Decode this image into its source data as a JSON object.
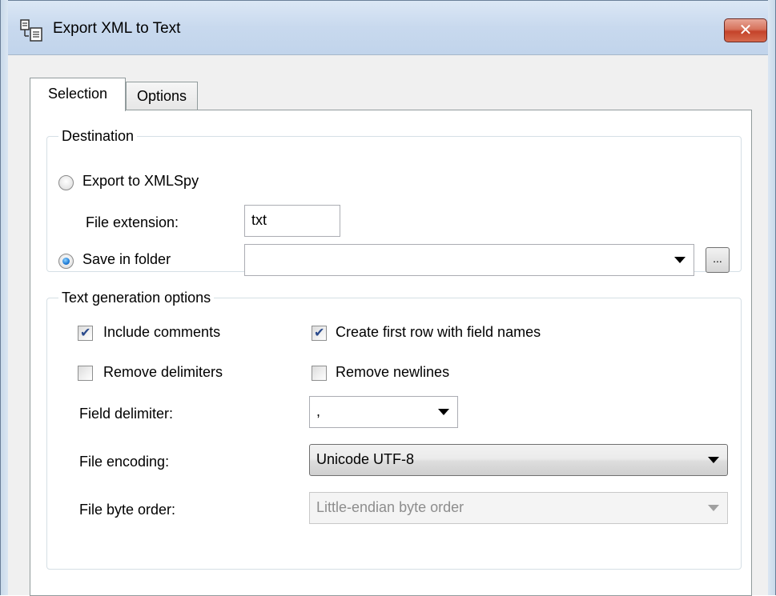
{
  "window": {
    "title": "Export XML to Text",
    "close_glyph": "✕",
    "icon": "export-text-icon"
  },
  "tabs": [
    {
      "label": "Selection",
      "active": true
    },
    {
      "label": "Options",
      "active": false
    }
  ],
  "destination": {
    "legend": "Destination",
    "export_radio_label": "Export to XMLSpy",
    "export_radio_checked": false,
    "file_extension_label": "File extension:",
    "file_extension_value": "txt",
    "save_radio_label": "Save in folder",
    "save_radio_checked": true,
    "folder_value": "",
    "browse_label": "..."
  },
  "text_options": {
    "legend": "Text generation options",
    "include_comments_label": "Include comments",
    "include_comments_checked": true,
    "create_first_row_label": "Create first row with field names",
    "create_first_row_checked": true,
    "remove_delimiters_label": "Remove delimiters",
    "remove_delimiters_checked": false,
    "remove_newlines_label": "Remove newlines",
    "remove_newlines_checked": false,
    "field_delimiter_label": "Field delimiter:",
    "field_delimiter_value": ",",
    "file_encoding_label": "File encoding:",
    "file_encoding_value": "Unicode UTF-8",
    "file_byte_order_label": "File byte order:",
    "file_byte_order_value": "Little-endian byte order",
    "file_byte_order_enabled": false
  },
  "colors": {
    "close_button": "#c4432a",
    "titlebar": "#c8d9ee",
    "radio_selected": "#1f7bd6"
  }
}
